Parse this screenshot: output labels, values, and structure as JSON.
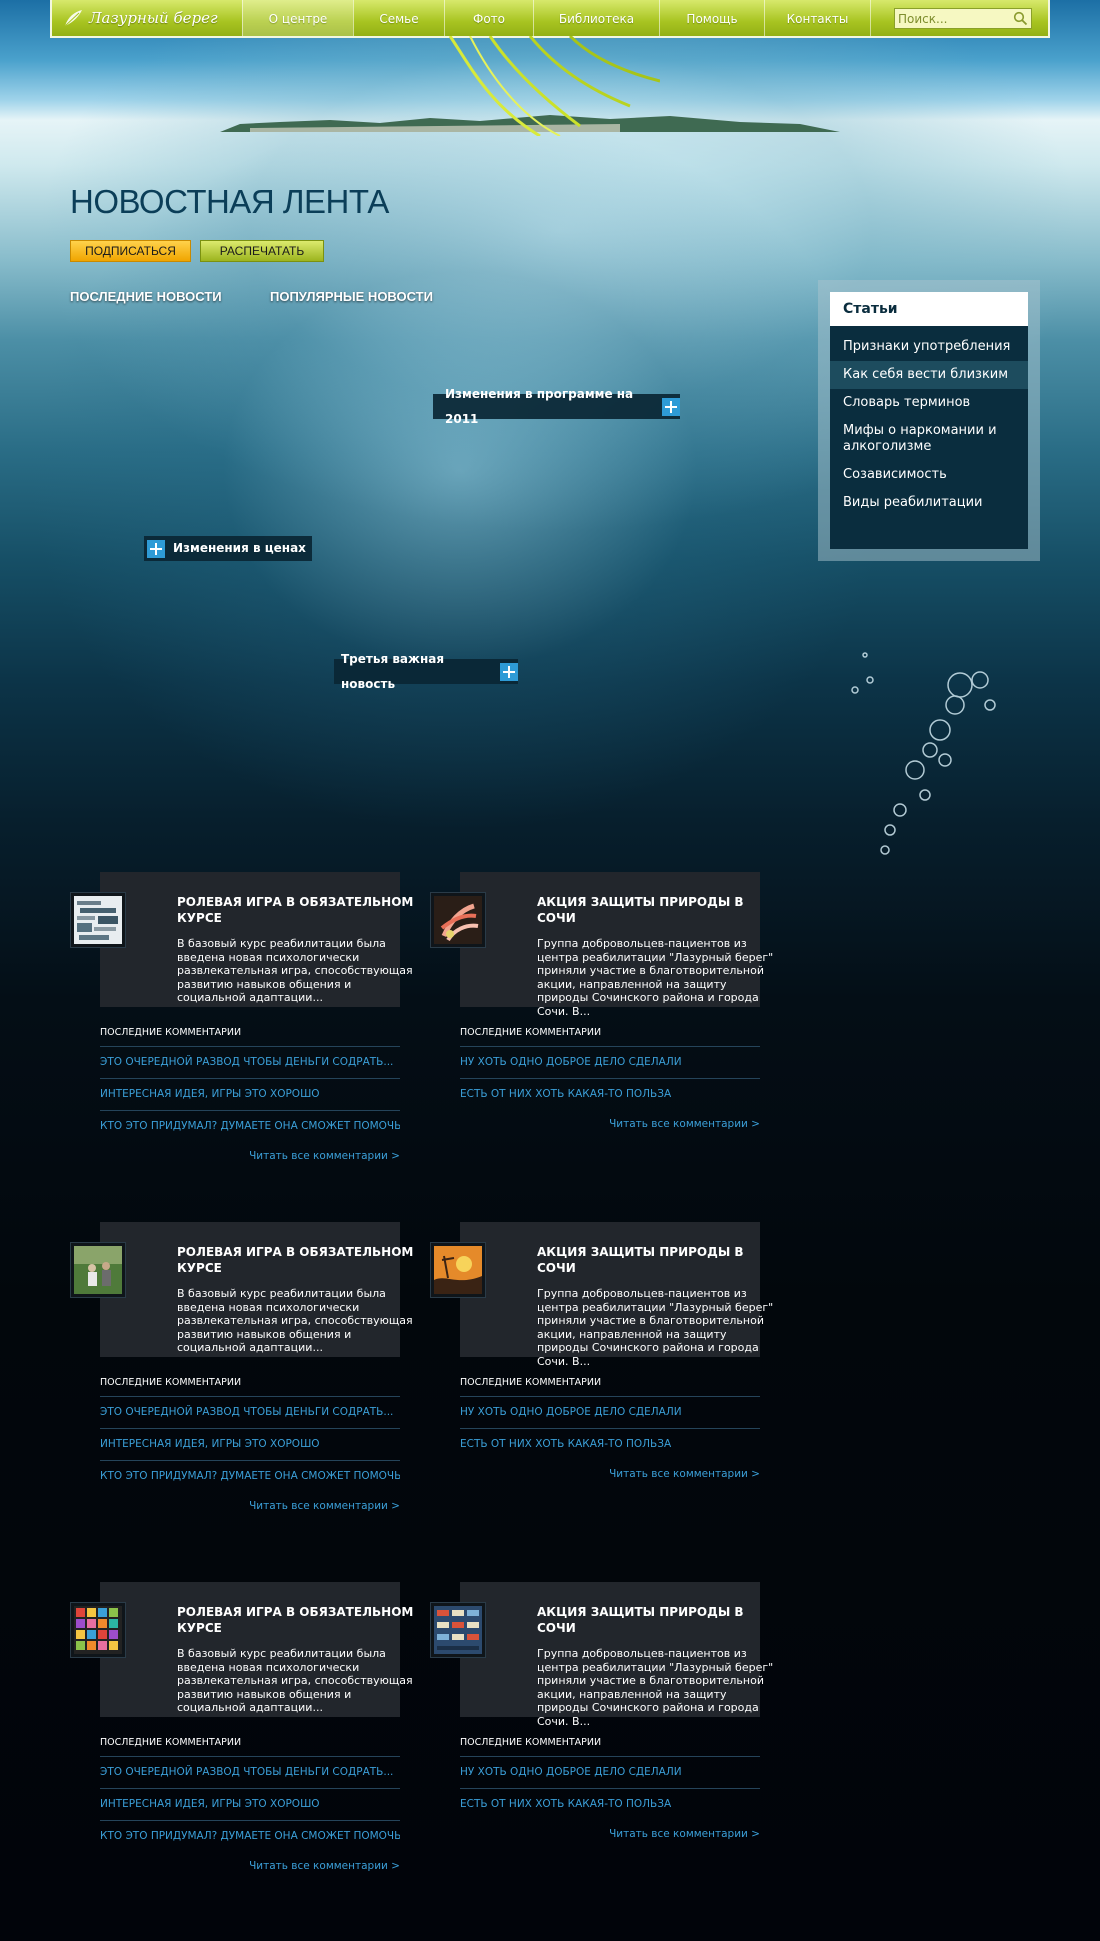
{
  "nav": {
    "logo": "Лазурный берег",
    "items": [
      {
        "label": "О центре",
        "active": true
      },
      {
        "label": "Семье"
      },
      {
        "label": "Фото"
      },
      {
        "label": "Библиотека"
      },
      {
        "label": "Помощь"
      },
      {
        "label": "Контакты"
      }
    ],
    "search_placeholder": "Поиск..."
  },
  "page": {
    "title": "НОВОСТНАЯ ЛЕНТА",
    "subscribe": "ПОДПИСАТЬСЯ",
    "print": "РАСПЕЧАТАТЬ",
    "tab_latest": "ПОСЛЕДНИЕ НОВОСТИ",
    "tab_popular": "ПОПУЛЯРНЫЕ НОВОСТИ"
  },
  "popups": [
    {
      "label": "Изменения в программе на 2011"
    },
    {
      "label": "Изменения в ценах"
    },
    {
      "label": "Третья важная новость"
    }
  ],
  "sidebar": {
    "title": "Статьи",
    "items": [
      {
        "label": "Признаки употребления"
      },
      {
        "label": "Как себя вести близким"
      },
      {
        "label": "Словарь терминов"
      },
      {
        "label": "Мифы о наркомании и алкоголизме"
      },
      {
        "label": "Созависимость"
      },
      {
        "label": "Виды реабилитации"
      }
    ]
  },
  "articles": [
    {
      "title": "Ролевая игра в обязательном курсе",
      "text": "В базовый курс реабилитации была введена новая психологически развлекательная игра, способствующая развитию навыков общения и социальной адаптации...",
      "comments_head": "Последние комментарии",
      "comments": [
        "Это очередной развод чтобы деньги содрать...",
        "Интересная идея, игры это хорошо",
        "Кто это придумал? Думаете она сможет помочь..."
      ],
      "read_all": "Читать все комментарии >"
    },
    {
      "title": "Акция защиты природы в Сочи",
      "text": "Группа добровольцев-пациентов из центра реабилитации \"Лазурный берег\" приняли участие в благотворительной акции, направленной на защиту природы Сочинского района и города Сочи. В...",
      "comments_head": "Последние комментарии",
      "comments": [
        "Ну хоть одно доброе дело сделали",
        "Есть от них хоть какая-то польза"
      ],
      "read_all": "Читать все комментарии >"
    },
    {
      "title": "Ролевая игра в обязательном курсе",
      "text": "В базовый курс реабилитации была введена новая психологически развлекательная игра, способствующая развитию навыков общения и социальной адаптации...",
      "comments_head": "Последние комментарии",
      "comments": [
        "Это очередной развод чтобы деньги содрать...",
        "Интересная идея, игры это хорошо",
        "Кто это придумал? Думаете она сможет помочь..."
      ],
      "read_all": "Читать все комментарии >"
    },
    {
      "title": "Акция защиты природы в Сочи",
      "text": "Группа добровольцев-пациентов из центра реабилитации \"Лазурный берег\" приняли участие в благотворительной акции, направленной на защиту природы Сочинского района и города Сочи. В...",
      "comments_head": "Последние комментарии",
      "comments": [
        "Ну хоть одно доброе дело сделали",
        "Есть от них хоть какая-то польза"
      ],
      "read_all": "Читать все комментарии >"
    },
    {
      "title": "Ролевая игра в обязательном курсе",
      "text": "В базовый курс реабилитации была введена новая психологически развлекательная игра, способствующая развитию навыков общения и социальной адаптации...",
      "comments_head": "Последние комментарии",
      "comments": [
        "Это очередной развод чтобы деньги содрать...",
        "Интересная идея, игры это хорошо",
        "Кто это придумал? Думаете она сможет помочь..."
      ],
      "read_all": "Читать все комментарии >"
    },
    {
      "title": "Акция защиты природы в Сочи",
      "text": "Группа добровольцев-пациентов из центра реабилитации \"Лазурный берег\" приняли участие в благотворительной акции, направленной на защиту природы Сочинского района и города Сочи. В...",
      "comments_head": "Последние комментарии",
      "comments": [
        "Ну хоть одно доброе дело сделали",
        "Есть от них хоть какая-то польза"
      ],
      "read_all": "Читать все комментарии >"
    }
  ]
}
